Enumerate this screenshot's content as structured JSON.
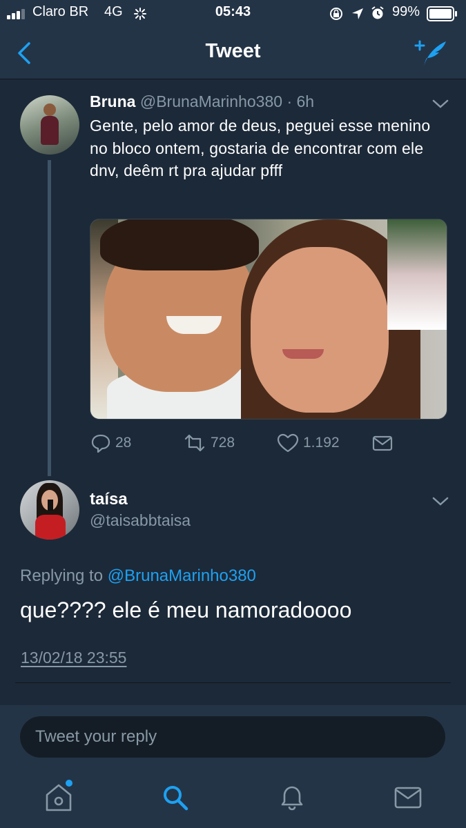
{
  "status_bar": {
    "carrier": "Claro BR",
    "network": "4G",
    "time": "05:43",
    "battery": "99%"
  },
  "nav": {
    "title": "Tweet",
    "back_icon": "chevron-left-icon",
    "compose_icon": "compose-feather-icon"
  },
  "tweet": {
    "author_name": "Bruna",
    "handle": "@BrunaMarinho380",
    "time_ago": "· 6h",
    "text": "Gente, pelo amor de deus, peguei esse menino no bloco ontem, gostaria de encontrar com ele dnv, deêm rt pra ajudar pfff",
    "replies": "28",
    "retweets": "728",
    "likes": "1.192"
  },
  "reply": {
    "author_name": "taísa",
    "handle": "@taisabbtaisa",
    "replying_prefix": "Replying to",
    "replying_handle": "@BrunaMarinho380",
    "text": "que???? ele é meu namoradoooo",
    "timestamp": "13/02/18 23:55"
  },
  "composer": {
    "placeholder": "Tweet your reply"
  },
  "tabbar": {
    "items": [
      "home-icon",
      "search-icon",
      "notifications-icon",
      "messages-icon"
    ]
  },
  "colors": {
    "background": "#1c2938",
    "bar": "#243447",
    "accent": "#1da1f2",
    "muted": "#8899a6"
  }
}
